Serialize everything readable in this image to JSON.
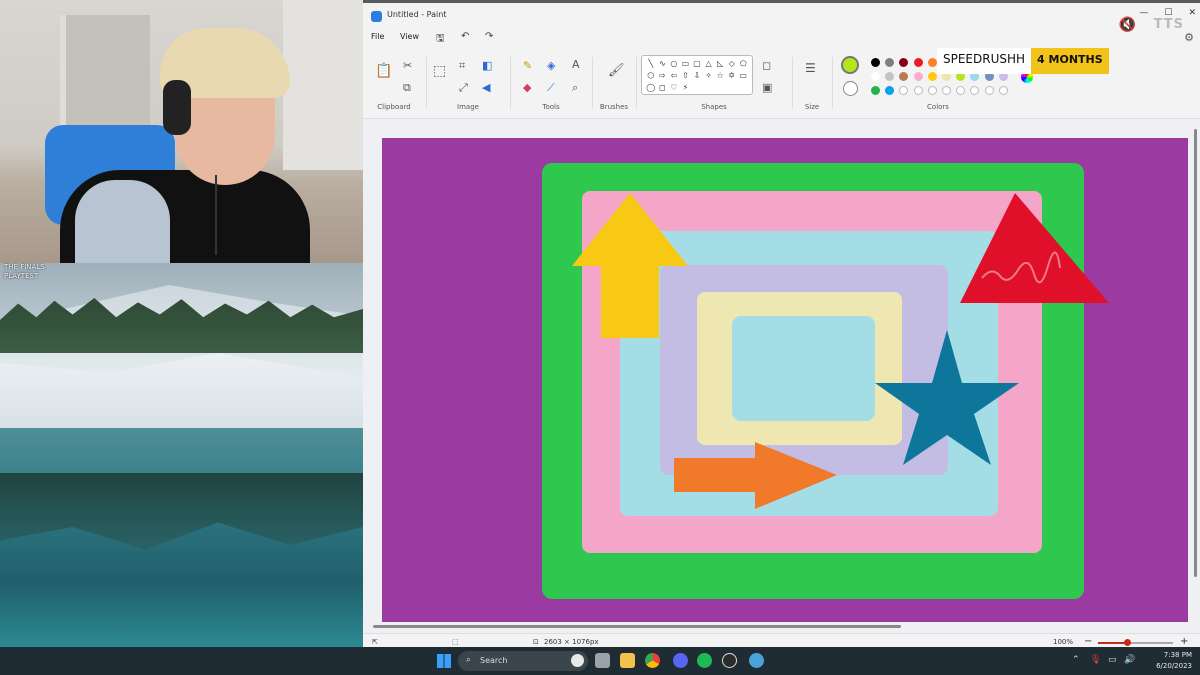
{
  "stream": {
    "game_overlay_text": "THE FINALS\nPLAYTEST"
  },
  "paint": {
    "window_title": "Untitled - Paint",
    "window_controls": [
      "—",
      "☐",
      "✕"
    ],
    "menu": [
      "File",
      "View"
    ],
    "groups": {
      "clipboard": "Clipboard",
      "image": "Image",
      "tools": "Tools",
      "brushes": "Brushes",
      "shapes": "Shapes",
      "size": "Size",
      "colors": "Colors"
    },
    "shape_glyphs": [
      "╲",
      "∿",
      "○",
      "▭",
      "▢",
      "△",
      "◺",
      "◇",
      "⬠",
      "⬡",
      "⇨",
      "⇦",
      "⇧",
      "⇩",
      "✧",
      "☆",
      "✡",
      "▭",
      "◯",
      "◻",
      "♡",
      "⚡",
      "",
      ""
    ],
    "palette_row1": [
      "#000000",
      "#7f7f7f",
      "#880015",
      "#ed1c24",
      "#ff7f27"
    ],
    "palette_row2": [
      "#ffffff",
      "#c3c3c3",
      "#b97a57",
      "#ffaec9",
      "#ffc90e",
      "#efe4b0",
      "#b5e61d",
      "#99d9ea",
      "#7092be",
      "#c8bfe7"
    ],
    "palette_row3": [
      "#22b14c",
      "#00a2e8"
    ],
    "selected_color": "#b5e61d",
    "canvas_size_text": "2603 × 1076px",
    "zoom_text": "100%",
    "zoom_level": 0.38
  },
  "overlay": {
    "sub_name": "SPEEDRUSHH",
    "sub_months": "4 MONTHS",
    "tts_label": "TTS"
  },
  "canvas_drawing": {
    "background": "#9b3aa0",
    "green": "#2ec84e",
    "pink": "#f3a6c8",
    "light_blue": "#a5dde6",
    "lavender": "#c3bde4",
    "cream": "#efe7b2",
    "inner_blue": "#a5dde6",
    "yellow_arrow": "#f7c914",
    "red_triangle": "#e0102a",
    "blue_star": "#0e769b",
    "orange_arrow": "#f07a2a"
  },
  "taskbar": {
    "search_placeholder": "Search",
    "time": "7:38 PM",
    "date": "6/20/2023"
  }
}
